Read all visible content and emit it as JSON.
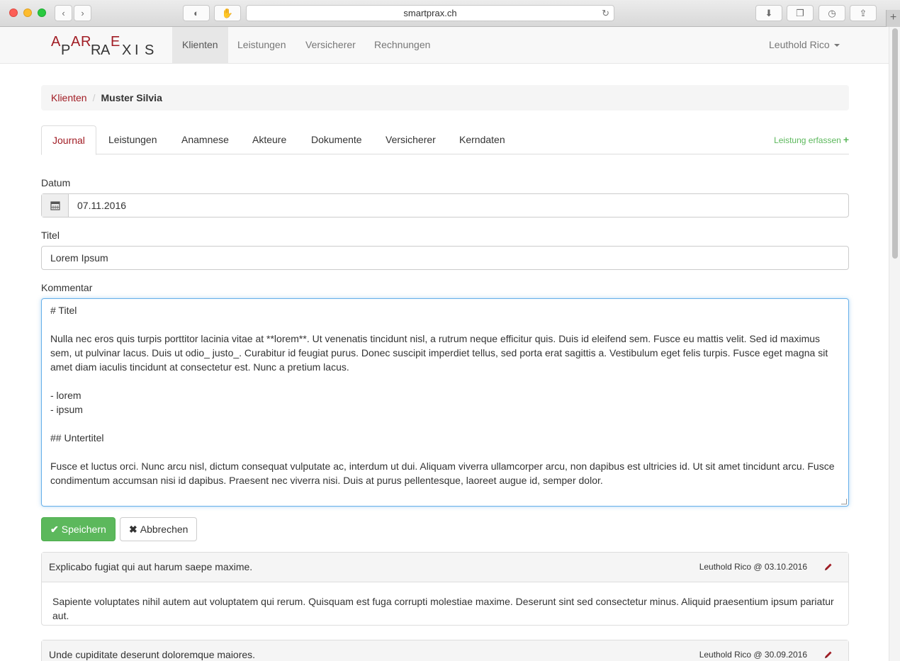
{
  "browser": {
    "url": "smartprax.ch"
  },
  "navbar": {
    "logo_letters": [
      "A",
      "P",
      "A",
      "R",
      "R",
      "A",
      "E",
      "X",
      "I",
      "S"
    ],
    "items": [
      {
        "label": "Klienten",
        "active": true
      },
      {
        "label": "Leistungen",
        "active": false
      },
      {
        "label": "Versicherer",
        "active": false
      },
      {
        "label": "Rechnungen",
        "active": false
      }
    ],
    "user": "Leuthold Rico"
  },
  "breadcrumb": {
    "parent": "Klienten",
    "separator": "/",
    "current": "Muster Silvia"
  },
  "tabs": {
    "items": [
      {
        "label": "Journal",
        "active": true
      },
      {
        "label": "Leistungen",
        "active": false
      },
      {
        "label": "Anamnese",
        "active": false
      },
      {
        "label": "Akteure",
        "active": false
      },
      {
        "label": "Dokumente",
        "active": false
      },
      {
        "label": "Versicherer",
        "active": false
      },
      {
        "label": "Kerndaten",
        "active": false
      }
    ],
    "add_action": "Leistung erfassen"
  },
  "form": {
    "date_label": "Datum",
    "date_value": "07.11.2016",
    "title_label": "Titel",
    "title_value": "Lorem Ipsum",
    "comment_label": "Kommentar",
    "comment_lines": [
      "# Titel",
      "",
      "Nulla nec eros quis turpis porttitor lacinia vitae at **lorem**. Ut venenatis tincidunt nisl, a rutrum neque efficitur quis. Duis id eleifend sem. Fusce eu mattis velit. Sed id maximus sem, ut pulvinar lacus. Duis ut odio_ justo_. Curabitur id feugiat purus. Donec suscipit imperdiet tellus, sed porta erat sagittis a. Vestibulum eget felis turpis. Fusce eget magna sit amet diam iaculis tincidunt at consectetur est. Nunc a pretium lacus.",
      "",
      "- lorem",
      "- ipsum",
      "",
      "## Untertitel",
      "",
      "Fusce et luctus orci. Nunc arcu nisl, dictum consequat vulputate ac, interdum ut dui. Aliquam viverra ullamcorper arcu, non dapibus est ultricies id. Ut sit amet tincidunt arcu. Fusce condimentum accumsan nisi id dapibus. Praesent nec viverra nisi. Duis at purus pellentesque, laoreet augue id, semper dolor."
    ],
    "save_label": "Speichern",
    "cancel_label": "Abbrechen"
  },
  "journal_entries": [
    {
      "title": "Explicabo fugiat qui aut harum saepe maxime.",
      "meta": "Leuthold Rico @ 03.10.2016",
      "body": "Sapiente voluptates nihil autem aut voluptatem qui rerum. Quisquam est fuga corrupti molestiae maxime. Deserunt sint sed consectetur minus. Aliquid praesentium ipsum pariatur aut."
    },
    {
      "title": "Unde cupiditate deserunt doloremque maiores.",
      "meta": "Leuthold Rico @ 30.09.2016",
      "body": ""
    }
  ],
  "colors": {
    "brand": "#a11c24",
    "success": "#5cb85c",
    "focus": "#66afe9"
  }
}
